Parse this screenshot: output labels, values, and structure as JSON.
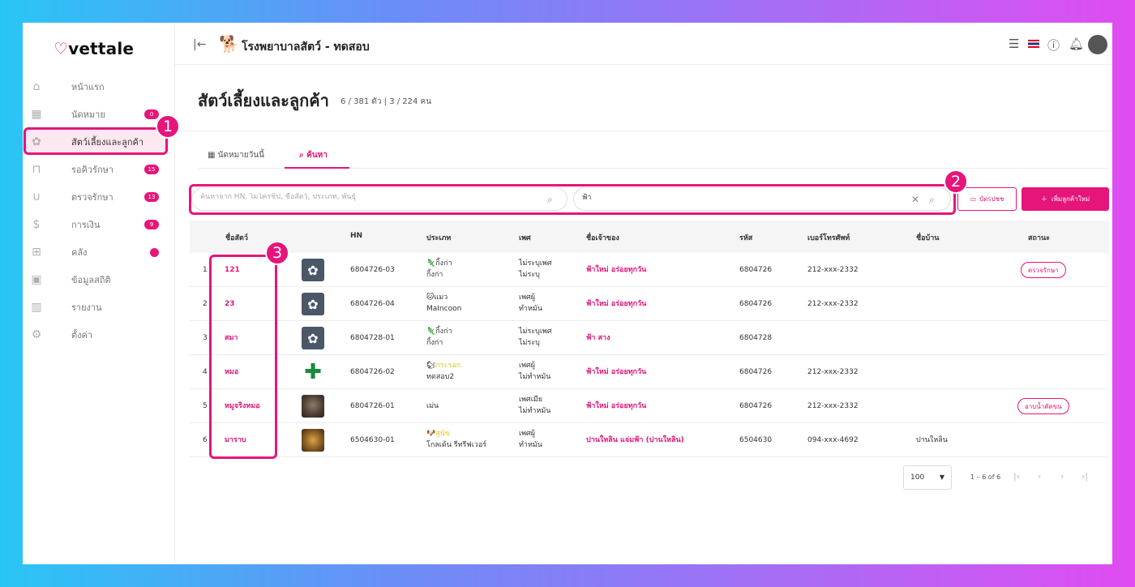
{
  "app": {
    "logo": "vettale",
    "clinic_name": "โรงพยาบาลสัตว์ - ทดสอบ"
  },
  "sidebar": {
    "items": [
      {
        "label": "หน้าแรก",
        "badge": ""
      },
      {
        "label": "นัดหมาย",
        "badge": "0"
      },
      {
        "label": "สัตว์เลี้ยงและลูกค้า",
        "badge": ""
      },
      {
        "label": "รอคิวรักษา",
        "badge": "15"
      },
      {
        "label": "ตรวจรักษา",
        "badge": "13"
      },
      {
        "label": "การเงิน",
        "badge": "9"
      },
      {
        "label": "คลัง",
        "badge": ""
      },
      {
        "label": "ข้อมูลสถิติ",
        "badge": ""
      },
      {
        "label": "รายงาน",
        "badge": ""
      },
      {
        "label": "ตั้งค่า",
        "badge": ""
      }
    ]
  },
  "markers": [
    "1",
    "2",
    "3"
  ],
  "page": {
    "title": "สัตว์เลี้ยงและลูกค้า",
    "count": "6 / 381 ตัว | 3 / 224 คน"
  },
  "tabs": [
    {
      "label": "นัดหมายวันนี้"
    },
    {
      "label": "ค้นหา"
    }
  ],
  "search": {
    "placeholder": "ค้นหาจาก HN, ไมโครชิป, ชื่อสัตว์, ประเภท, พันธุ์",
    "owner_value": "ฟ้า"
  },
  "buttons": {
    "card": "บัตรปชช",
    "add": "เพิ่มลูกค้าใหม่"
  },
  "table": {
    "headers": [
      "ชื่อสัตว์",
      "HN",
      "ประเภท",
      "เพศ",
      "ชื่อเจ้าของ",
      "รหัส",
      "เบอร์โทรศัพท์",
      "ชื่อบ้าน",
      "สถานะ"
    ],
    "rows": [
      {
        "no": "1",
        "name": "121",
        "hn": "6804726-03",
        "type": "กิ้งก่า",
        "breed": "กิ้งก่า",
        "sex": "ไม่ระบุเพศ",
        "sterile": "ไม่ระบุ",
        "owner": "ฟ้าใหม่ อร่อยทุกวัน",
        "code": "6804726",
        "phone": "212-xxx-2332",
        "house": "",
        "status": "ตรวจรักษา"
      },
      {
        "no": "2",
        "name": "23",
        "hn": "6804726-04",
        "type": "แมว",
        "breed": "MaIncoon",
        "sex": "เพศผู้",
        "sterile": "ทำหมัน",
        "owner": "ฟ้าใหม่ อร่อยทุกวัน",
        "code": "6804726",
        "phone": "212-xxx-2332",
        "house": "",
        "status": ""
      },
      {
        "no": "3",
        "name": "สมา",
        "hn": "6804728-01",
        "type": "กิ้งก่า",
        "breed": "กิ้งก่า",
        "sex": "ไม่ระบุเพศ",
        "sterile": "ไม่ระบุ",
        "owner": "ฟ้า สาง",
        "code": "6804728",
        "phone": "",
        "house": "",
        "status": ""
      },
      {
        "no": "4",
        "name": "หมอ",
        "hn": "6804726-02",
        "type": "กระรอก",
        "breed": "ทดสอบ2",
        "sex": "เพศผู้",
        "sterile": "ไม่ทำหมัน",
        "owner": "ฟ้าใหม่ อร่อยทุกวัน",
        "code": "6804726",
        "phone": "212-xxx-2332",
        "house": "",
        "status": ""
      },
      {
        "no": "5",
        "name": "หมูจริงหมอ",
        "hn": "6804726-01",
        "type": "เม่น",
        "breed": "",
        "sex": "เพศเมีย",
        "sterile": "ไม่ทำหมัน",
        "owner": "ฟ้าใหม่ อร่อยทุกวัน",
        "code": "6804726",
        "phone": "212-xxx-2332",
        "house": "",
        "status": "อาบน้ำตัดขน"
      },
      {
        "no": "6",
        "name": "มาราบ",
        "hn": "6504630-01",
        "type": "สุนัข",
        "breed": "โกลเด้น รีทรีฟเวอร์",
        "sex": "เพศผู้",
        "sterile": "ทำหมัน",
        "owner": "ปานใหลิน แจ่มฟ้า (ปานใหลิน)",
        "code": "6504630",
        "phone": "094-xxx-4692",
        "house": "ปานใหลิน",
        "status": ""
      }
    ]
  },
  "pagination": {
    "per_page": "100",
    "range": "1 – 6 of 6"
  },
  "colors": {
    "accent": "#e6157a"
  }
}
